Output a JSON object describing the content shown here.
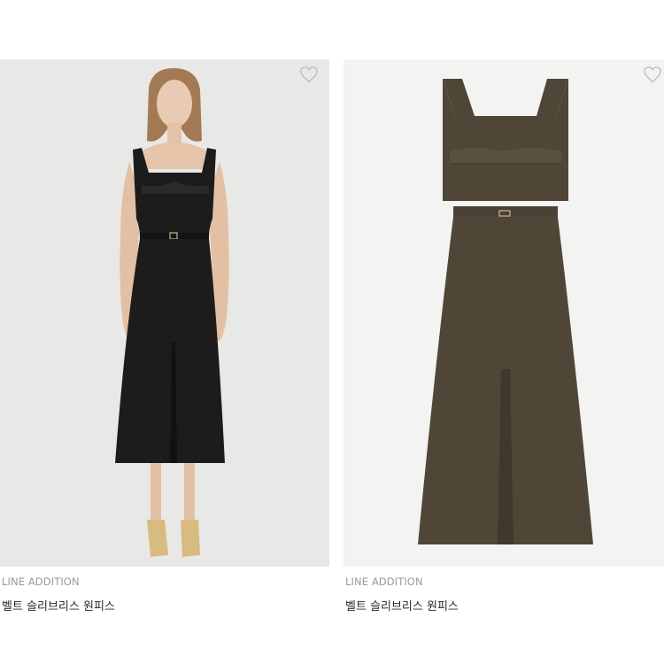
{
  "products": [
    {
      "brand": "LINE ADDITION",
      "name": "벨트 슬리브리스 원피스",
      "color_name": "black",
      "color_hex": "#1c1c1c",
      "photo_type": "model",
      "wishlist_icon": "heart-outline-icon"
    },
    {
      "brand": "LINE ADDITION",
      "name": "벨트 슬리브리스 원피스",
      "color_name": "khaki",
      "color_hex": "#4f4637",
      "photo_type": "flat",
      "wishlist_icon": "heart-outline-icon"
    }
  ]
}
